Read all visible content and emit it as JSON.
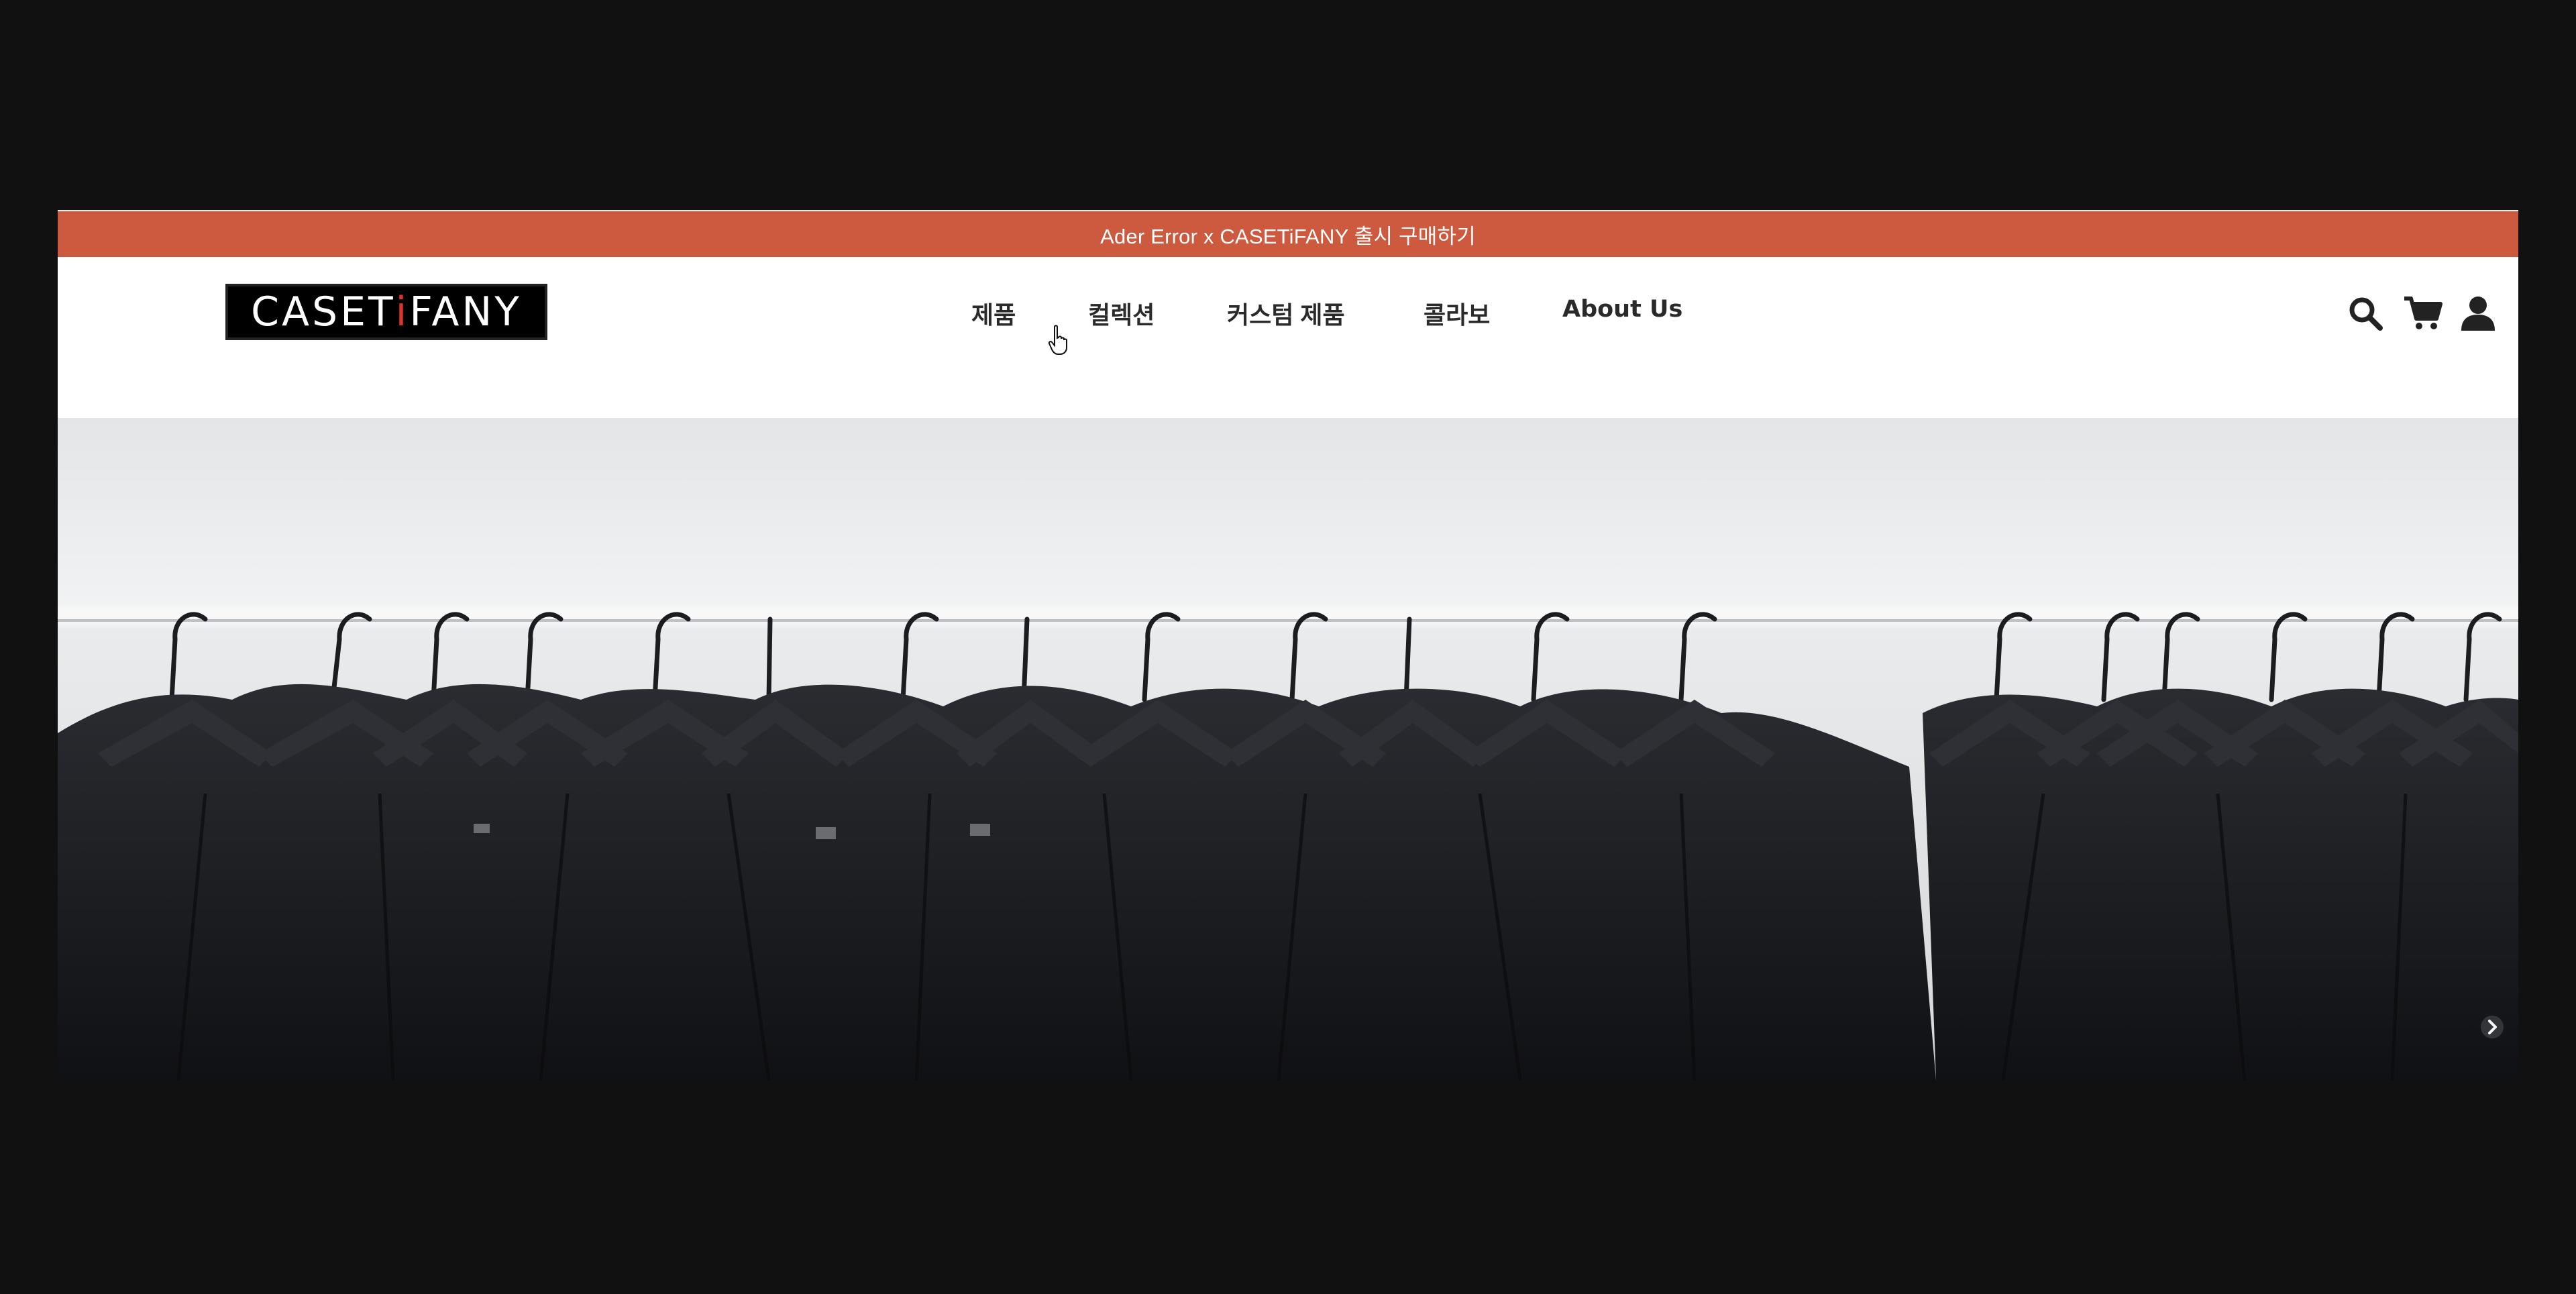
{
  "promo": {
    "text": "Ader Error x CASETiFANY 출시 구매하기"
  },
  "logo": {
    "text_before": "CASET",
    "text_i": "i",
    "text_after": "FANY"
  },
  "nav": {
    "items": [
      {
        "label": "제품"
      },
      {
        "label": "컬렉션"
      },
      {
        "label": "커스텀 제품"
      },
      {
        "label": "콜라보"
      },
      {
        "label": "About Us"
      }
    ]
  },
  "icons": {
    "search": "search-icon",
    "cart": "cart-icon",
    "account": "user-icon",
    "next": "chevron-right-icon"
  },
  "colors": {
    "promo_bg": "#cd593e",
    "page_bg": "#111112",
    "nav_text": "#2a2a2a"
  },
  "hero": {
    "image": "black shirts on hangers on a clothing rack"
  }
}
